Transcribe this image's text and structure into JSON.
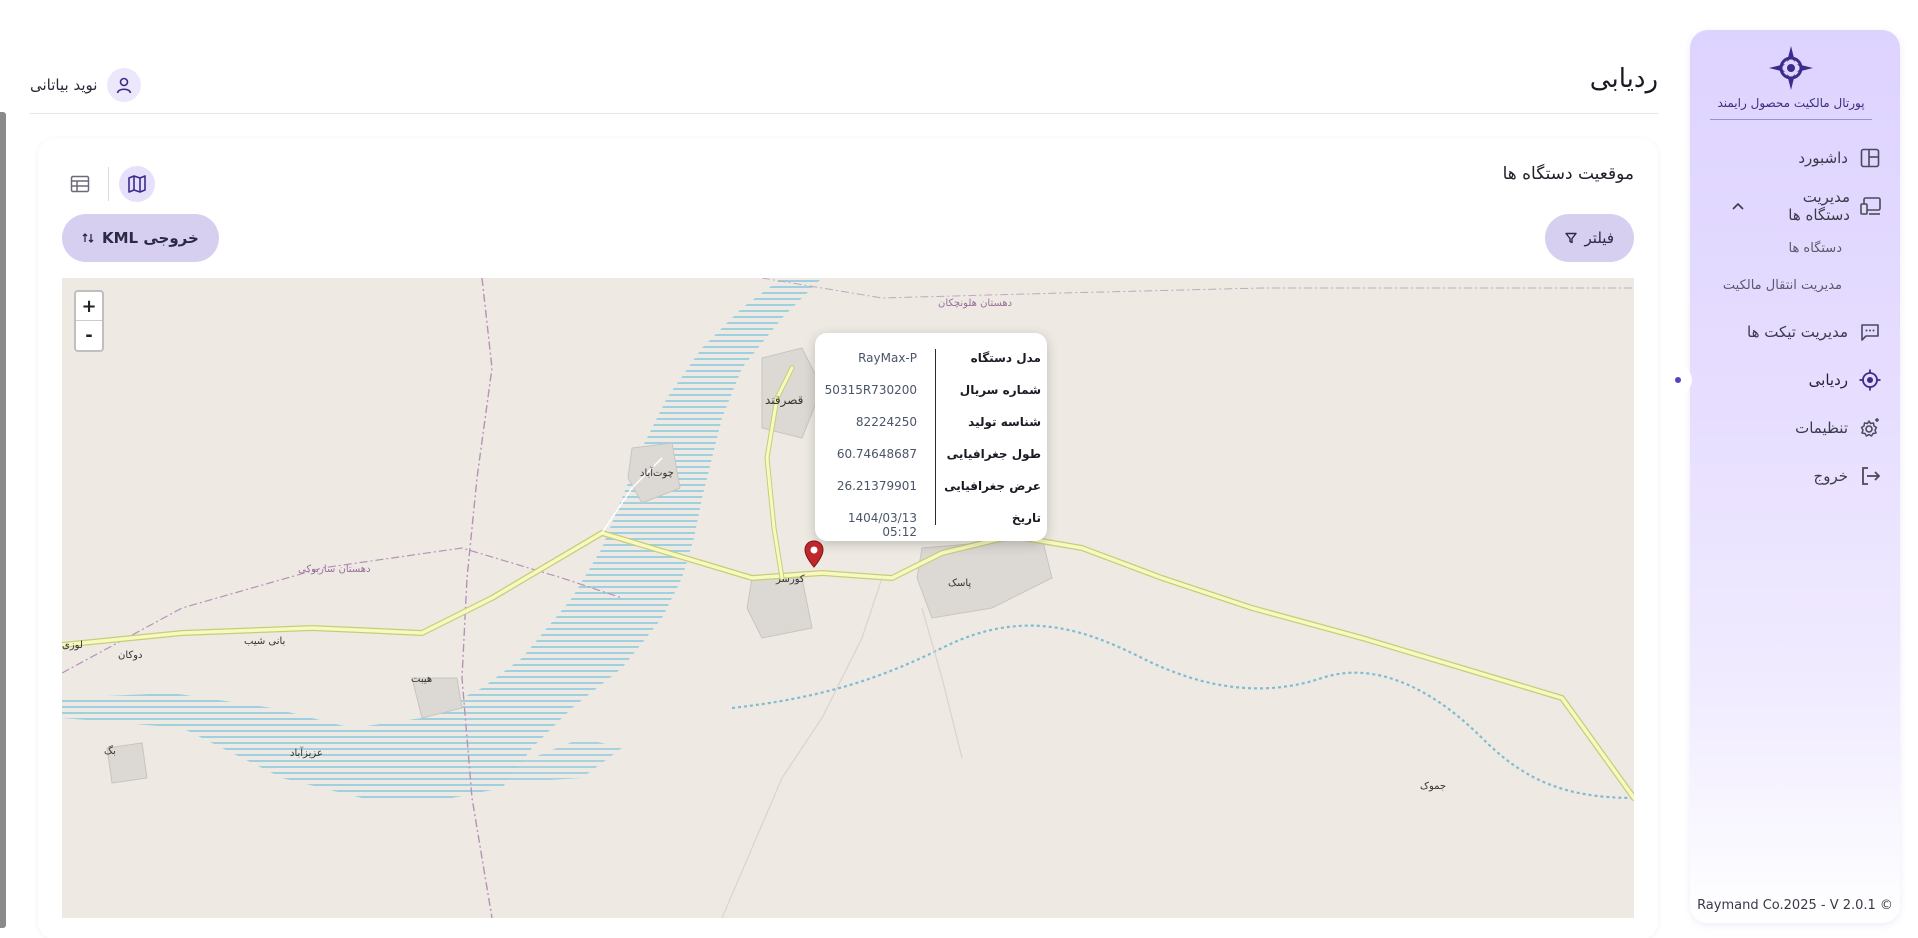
{
  "app": {
    "name": "پورتال مالکیت محصول رایمند",
    "copyright": "Raymand Co.2025 - V 2.0.1 ©"
  },
  "sidebar": {
    "items": [
      {
        "label": "داشبورد",
        "icon": "dashboard-icon"
      },
      {
        "label": "مدیریت دستگاه ها",
        "icon": "devices-icon",
        "expanded": true,
        "children": [
          {
            "label": "دستگاه ها"
          },
          {
            "label": "مدیریت انتقال مالکیت"
          }
        ]
      },
      {
        "label": "مدیریت تیکت ها",
        "icon": "tickets-icon"
      },
      {
        "label": "ردیابی",
        "icon": "tracking-icon",
        "active": true
      },
      {
        "label": "تنظیمات",
        "icon": "settings-icon"
      },
      {
        "label": "خروج",
        "icon": "logout-icon"
      }
    ]
  },
  "header": {
    "title": "ردیابی",
    "user_name": "نوید بیاتانی"
  },
  "card": {
    "title": "موقعیت دستگاه ها",
    "filter_label": "فیلتر",
    "kml_label": "خروجی KML"
  },
  "map": {
    "zoom_in": "+",
    "zoom_out": "-",
    "popup": {
      "rows": [
        {
          "key": "مدل دستگاه",
          "value": "RayMax-P"
        },
        {
          "key": "شماره سریال",
          "value": "50315R730200"
        },
        {
          "key": "شناسه تولید",
          "value": "82224250"
        },
        {
          "key": "طول جغرافیایی",
          "value": "60.74648687"
        },
        {
          "key": "عرض جغرافیایی",
          "value": "26.21379901"
        },
        {
          "key": "تاریخ",
          "value": "1404/03/13 05:12"
        }
      ]
    },
    "labels": {
      "qasrqand": "قصرقند",
      "chotabad": "چوت‌آباد",
      "kursar": "کورسر",
      "pask": "پاسک",
      "haybat": "هیبت",
      "azizabad": "عزیزآباد",
      "bag": "بگ",
      "dukan": "دوکان",
      "banishib": "بانی شیب",
      "lawzi": "لوزی",
      "jamuk": "جموک",
      "dehestan_sarbuki": "دهستان ساربوکی",
      "dehestan_holunchakan": "دهستان هلونچکان"
    },
    "colors": {
      "water": "#aad3df",
      "road": "#f7fabf",
      "road_edge": "#c8cc7a",
      "land": "#eeeae3",
      "marker": "#c0272d"
    }
  }
}
